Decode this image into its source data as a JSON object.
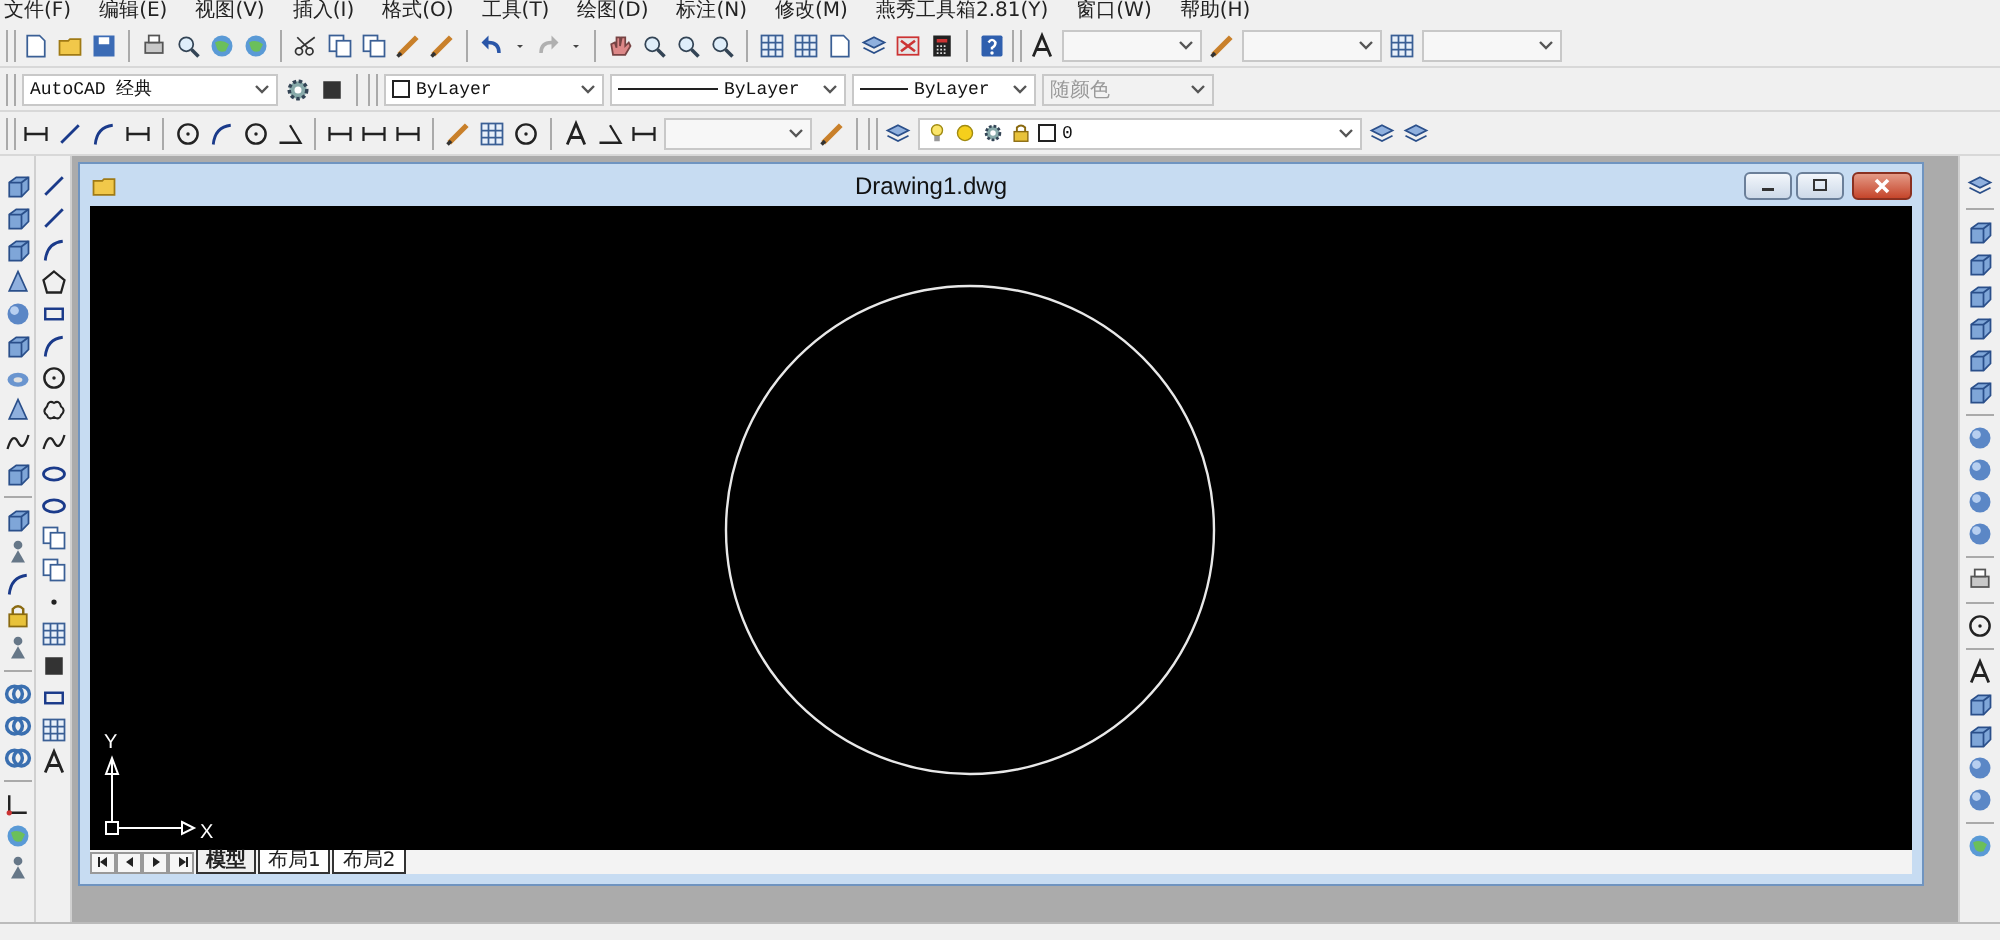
{
  "menu": [
    "文件(F)",
    "编辑(E)",
    "视图(V)",
    "插入(I)",
    "格式(O)",
    "工具(T)",
    "绘图(D)",
    "标注(N)",
    "修改(M)",
    "燕秀工具箱2.81(Y)",
    "窗口(W)",
    "帮助(H)"
  ],
  "combos": {
    "workspace": {
      "value": "AutoCAD 经典"
    },
    "color": {
      "value": "ByLayer"
    },
    "linetype": {
      "value": "ByLayer"
    },
    "lineweight": {
      "value": "ByLayer"
    },
    "plot_style": {
      "value": "随颜色",
      "disabled": true
    },
    "layer": {
      "value": "0"
    }
  },
  "drawing_window": {
    "title": "Drawing1.dwg",
    "ucs": {
      "x_label": "X",
      "y_label": "Y"
    },
    "tabs": [
      {
        "label": "模型",
        "selected": true
      },
      {
        "label": "布局1",
        "selected": false
      },
      {
        "label": "布局2",
        "selected": false
      }
    ]
  }
}
